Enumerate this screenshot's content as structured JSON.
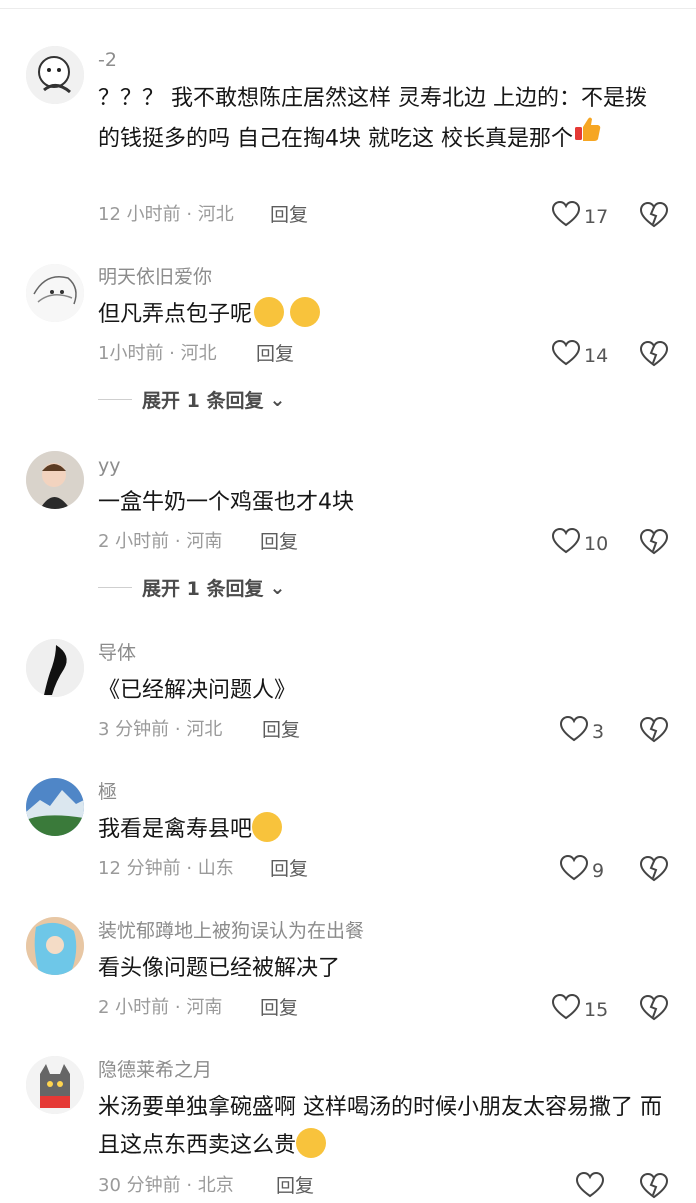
{
  "comments": [
    {
      "username": "-2",
      "text_main": "？？？ 我不敢想陈庄居然这样    灵寿北边 上边的：不是拨的钱挺多的吗  自己在掏4块    就吃这    校长真是那个",
      "emoji": "thumbs-up",
      "time": "12 小时前 · 河北",
      "reply": "回复",
      "likes": "17"
    },
    {
      "username": "明天依旧爱你",
      "text_main": "但凡弄点包子呢",
      "emoji": "pleading-face pleading-face",
      "time": "1小时前 · 河北",
      "reply": "回复",
      "likes": "14",
      "expand": "展开 1 条回复"
    },
    {
      "username": "yy",
      "text_main": "一盒牛奶一个鸡蛋也才4块",
      "time": "2 小时前 · 河南",
      "reply": "回复",
      "likes": "10",
      "expand": "展开 1 条回复"
    },
    {
      "username": "导体",
      "text_main": "《已经解决问题人》",
      "time": "3 分钟前 · 河北",
      "reply": "回复",
      "likes": "3"
    },
    {
      "username": "極",
      "text_main": "我看是禽寿县吧",
      "emoji": "loudly-crying-face",
      "time": "12 分钟前 · 山东",
      "reply": "回复",
      "likes": "9"
    },
    {
      "username": "装忧郁蹲地上被狗误认为在出餐",
      "text_main": "看头像问题已经被解决了",
      "time": "2 小时前 · 河南",
      "reply": "回复",
      "likes": "15"
    },
    {
      "username": "隐德莱希之月",
      "text_main": "米汤要单独拿碗盛啊  这样喝汤的时候小朋友太容易撒了  而且这点东西卖这么贵",
      "emoji": "flushed-face",
      "time": "30 分钟前 · 北京",
      "reply": "回复",
      "likes": ""
    }
  ]
}
